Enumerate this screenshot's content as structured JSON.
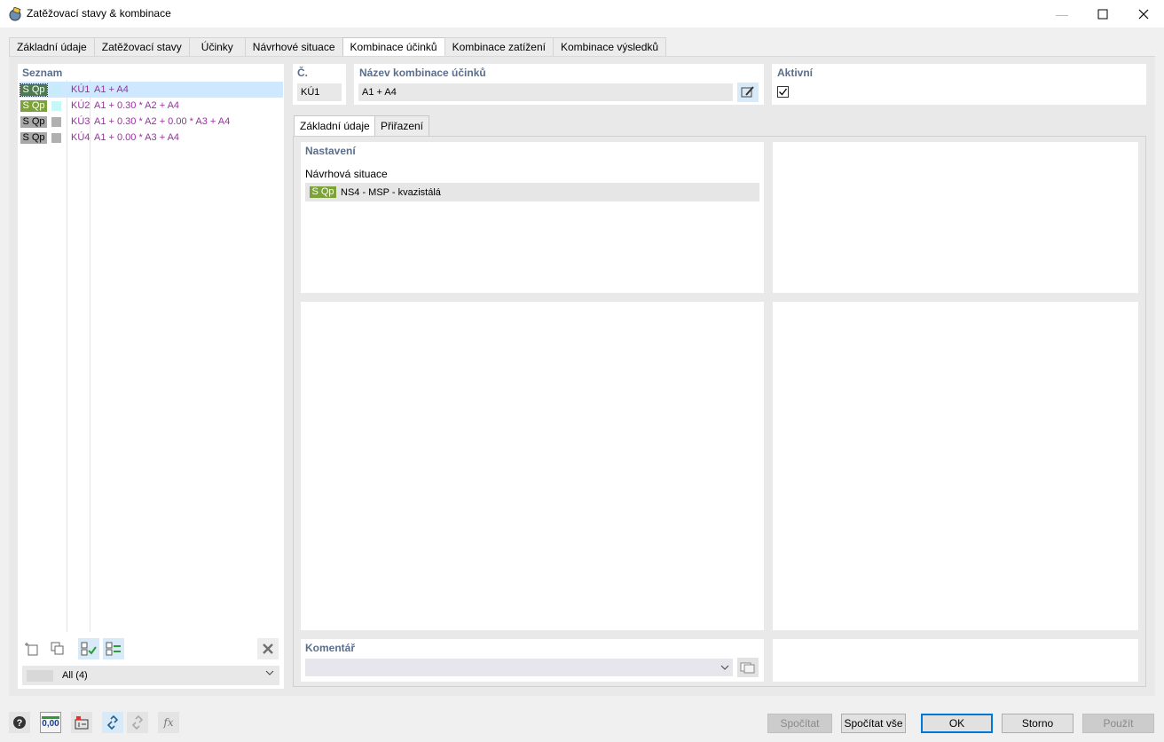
{
  "window": {
    "title": "Zatěžovací stavy & kombinace",
    "minimize_glyph": "—",
    "maximize_glyph": "☐",
    "close_glyph": "✕"
  },
  "tabs": [
    "Základní údaje",
    "Zatěžovací stavy",
    "Účinky",
    "Návrhové situace",
    "Kombinace účinků",
    "Kombinace zatížení",
    "Kombinace výsledků"
  ],
  "list": {
    "title": "Seznam",
    "items": [
      {
        "badge": "S Qp",
        "id": "KÚ1",
        "expr": "A1 + A4",
        "color": "#c7ecf9",
        "badge_color": "#4f7a4f"
      },
      {
        "badge": "S Qp",
        "id": "KÚ2",
        "expr": "A1 + 0.30 * A2 + A4",
        "color": "#c7f7f7",
        "badge_color": "#7ea23a"
      },
      {
        "badge": "S Qp",
        "id": "KÚ3",
        "expr": "A1 + 0.30 * A2 + 0.00 * A3 + A4",
        "color": "#b0b0b0",
        "badge_color": "#a8a8a8"
      },
      {
        "badge": "S Qp",
        "id": "KÚ4",
        "expr": "A1 + 0.00 * A3 + A4",
        "color": "#b0b0b0",
        "badge_color": "#a8a8a8"
      }
    ],
    "filter": "All (4)"
  },
  "header": {
    "no_label": "Č.",
    "no_value": "KÚ1",
    "name_label": "Název kombinace účinků",
    "name_value": "A1 + A4",
    "active_label": "Aktivní",
    "active_checked": true
  },
  "subtabs": [
    "Základní údaje",
    "Přiřazení"
  ],
  "settings": {
    "title": "Nastavení",
    "situation_label": "Návrhová situace",
    "situation_badge": "S Qp",
    "situation_value": "NS4 - MSP - kvazistálá"
  },
  "comment": {
    "label": "Komentář",
    "value": ""
  },
  "buttons": {
    "calculate": "Spočítat",
    "calculate_all": "Spočítat vše",
    "ok": "OK",
    "cancel": "Storno",
    "apply": "Použít"
  },
  "bottom_icon_value": "0,00"
}
